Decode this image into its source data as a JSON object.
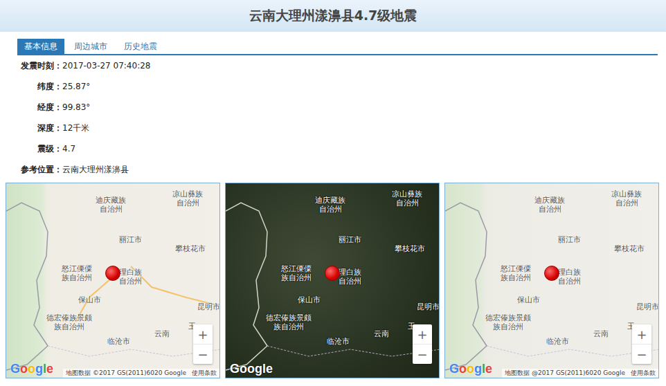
{
  "page": {
    "title": "云南大理州漾濞县4.7级地震"
  },
  "tabs": [
    {
      "label": "基本信息",
      "selected": true
    },
    {
      "label": "周边城市",
      "selected": false
    },
    {
      "label": "历史地震",
      "selected": false
    }
  ],
  "info": [
    {
      "label": "发震时刻：",
      "value": "2017-03-27 07:40:28"
    },
    {
      "label": "纬度：",
      "value": "25.87°"
    },
    {
      "label": "经度：",
      "value": "99.83°"
    },
    {
      "label": "深度：",
      "value": "12千米"
    },
    {
      "label": "震级：",
      "value": "4.7"
    },
    {
      "label": "参考位置：",
      "value": "云南大理州漾濞县"
    }
  ],
  "maps": [
    {
      "kind": "road",
      "logo": "Google",
      "attribution": "地图数据 ©2017 GS(2011)6020 Google",
      "terms": "使用条款",
      "zoom_in": "+",
      "zoom_out": "−"
    },
    {
      "kind": "satellite",
      "logo": "Google",
      "attribution": "",
      "terms": "",
      "zoom_in": "+",
      "zoom_out": "−"
    },
    {
      "kind": "terrain",
      "logo": "Google",
      "attribution": "地图数据 @2017 GS(2011)6020 Google",
      "terms": "使用条款",
      "zoom_in": "+",
      "zoom_out": "−"
    }
  ],
  "map_labels": [
    {
      "lines": [
        "迪庆藏族",
        "自治州"
      ]
    },
    {
      "lines": [
        "凉山彝族",
        "自治州"
      ]
    },
    {
      "lines": [
        "丽江市"
      ]
    },
    {
      "lines": [
        "攀枝花市"
      ]
    },
    {
      "lines": [
        "怒江傈僳",
        "族自治州"
      ]
    },
    {
      "lines": [
        "理白族",
        "自治州"
      ]
    },
    {
      "lines": [
        "保山市"
      ]
    },
    {
      "lines": [
        "昆明市"
      ]
    },
    {
      "lines": [
        "德宏傣族景颇",
        "族自治州"
      ]
    },
    {
      "lines": [
        "临沧市"
      ]
    },
    {
      "lines": [
        "云南"
      ]
    },
    {
      "lines": [
        "玉"
      ]
    }
  ]
}
